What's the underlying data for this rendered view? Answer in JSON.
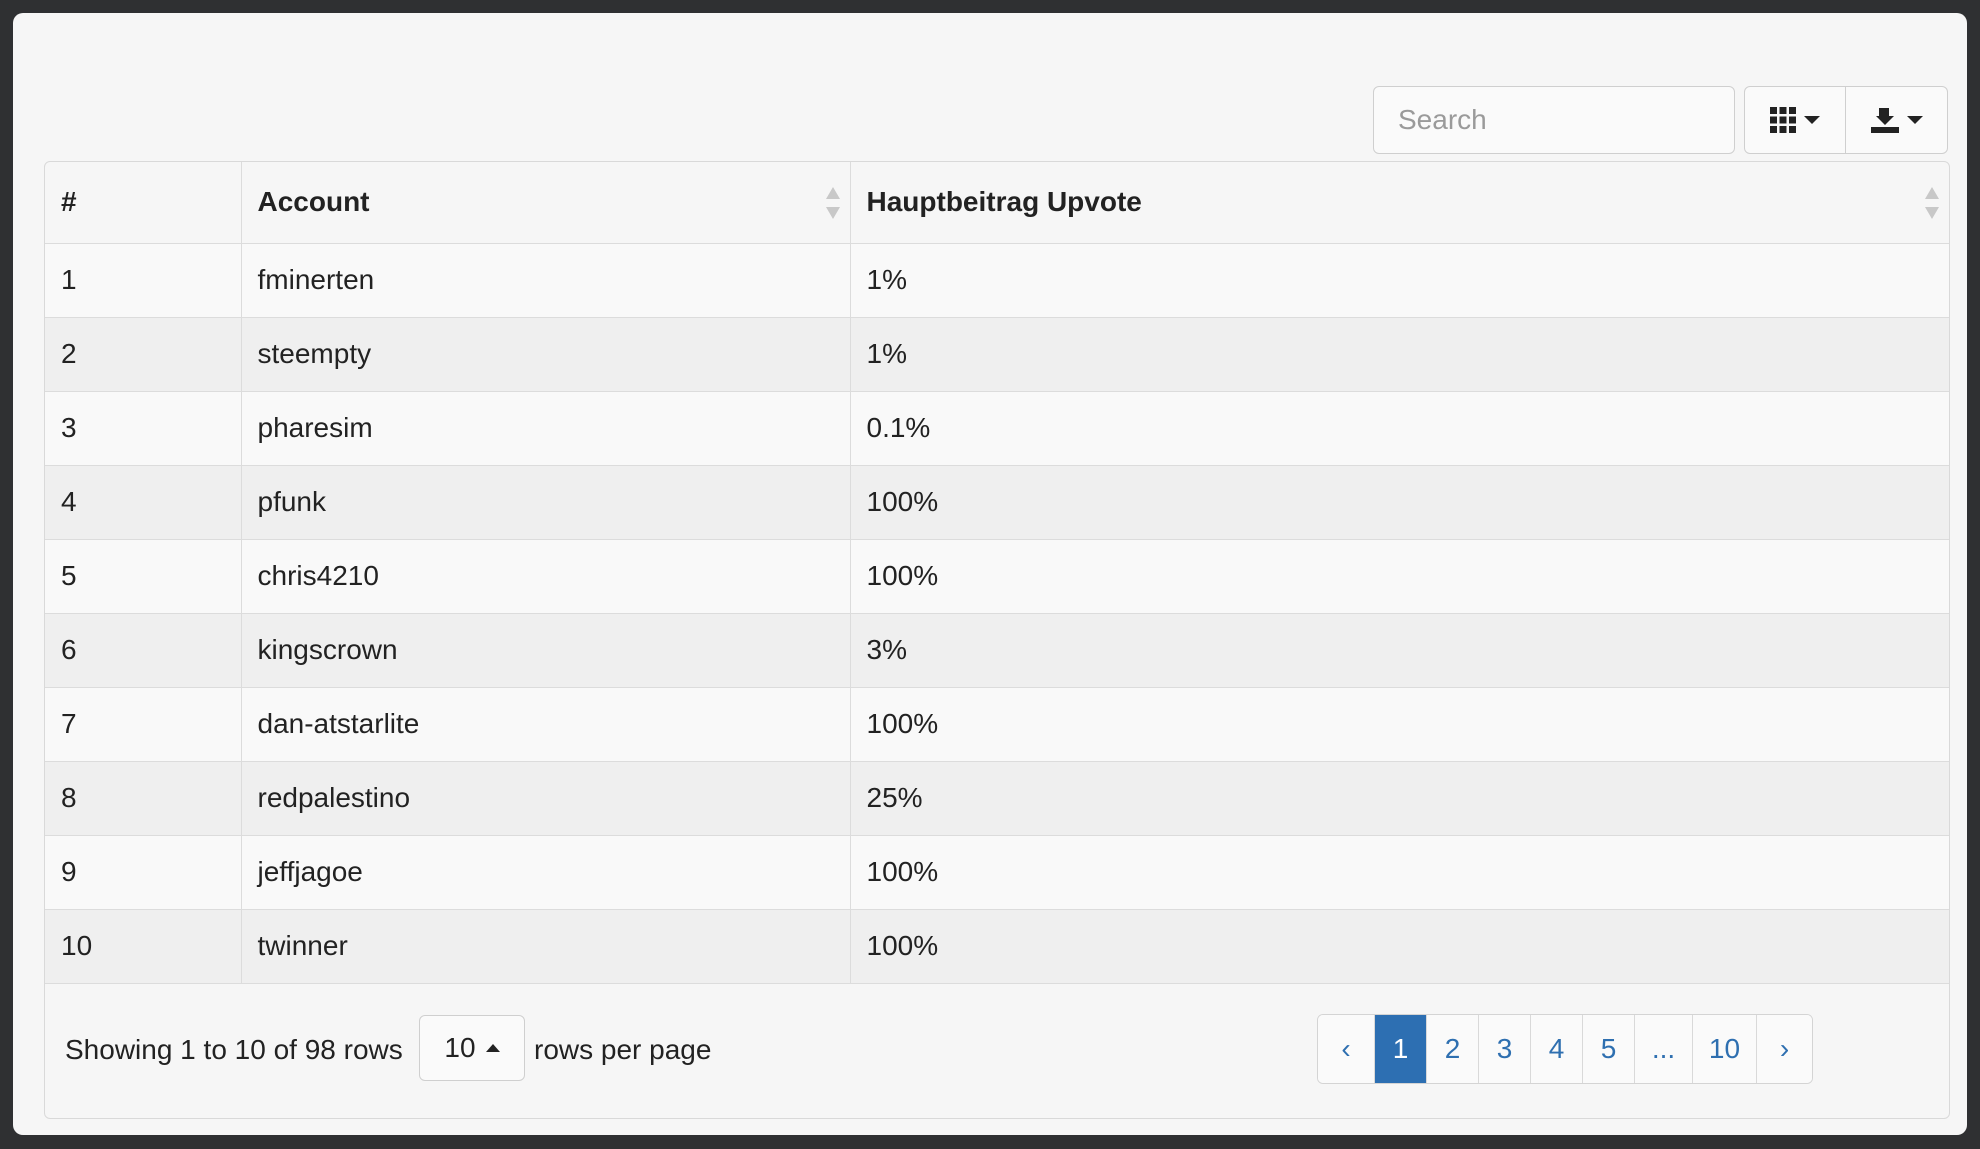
{
  "toolbar": {
    "search_placeholder": "Search",
    "columns_icon": "grid-icon",
    "export_icon": "download-icon"
  },
  "table": {
    "headers": [
      "#",
      "Account",
      "Hauptbeitrag Upvote"
    ],
    "rows": [
      {
        "num": "1",
        "account": "fminerten",
        "upvote": "1%"
      },
      {
        "num": "2",
        "account": "steempty",
        "upvote": "1%"
      },
      {
        "num": "3",
        "account": "pharesim",
        "upvote": "0.1%"
      },
      {
        "num": "4",
        "account": "pfunk",
        "upvote": "100%"
      },
      {
        "num": "5",
        "account": "chris4210",
        "upvote": "100%"
      },
      {
        "num": "6",
        "account": "kingscrown",
        "upvote": "3%"
      },
      {
        "num": "7",
        "account": "dan-atstarlite",
        "upvote": "100%"
      },
      {
        "num": "8",
        "account": "redpalestino",
        "upvote": "25%"
      },
      {
        "num": "9",
        "account": "jeffjagoe",
        "upvote": "100%"
      },
      {
        "num": "10",
        "account": "twinner",
        "upvote": "100%"
      }
    ]
  },
  "footer": {
    "showing": "Showing 1 to 10 of 98 rows",
    "page_size": "10",
    "rows_per_page": "rows per page"
  },
  "pagination": {
    "prev": "‹",
    "pages": [
      "1",
      "2",
      "3",
      "4",
      "5",
      "...",
      "10"
    ],
    "next": "›",
    "active": "1"
  },
  "colors": {
    "accent": "#2d6fb2",
    "link": "#2e6fb0",
    "background": "#2f3032"
  }
}
